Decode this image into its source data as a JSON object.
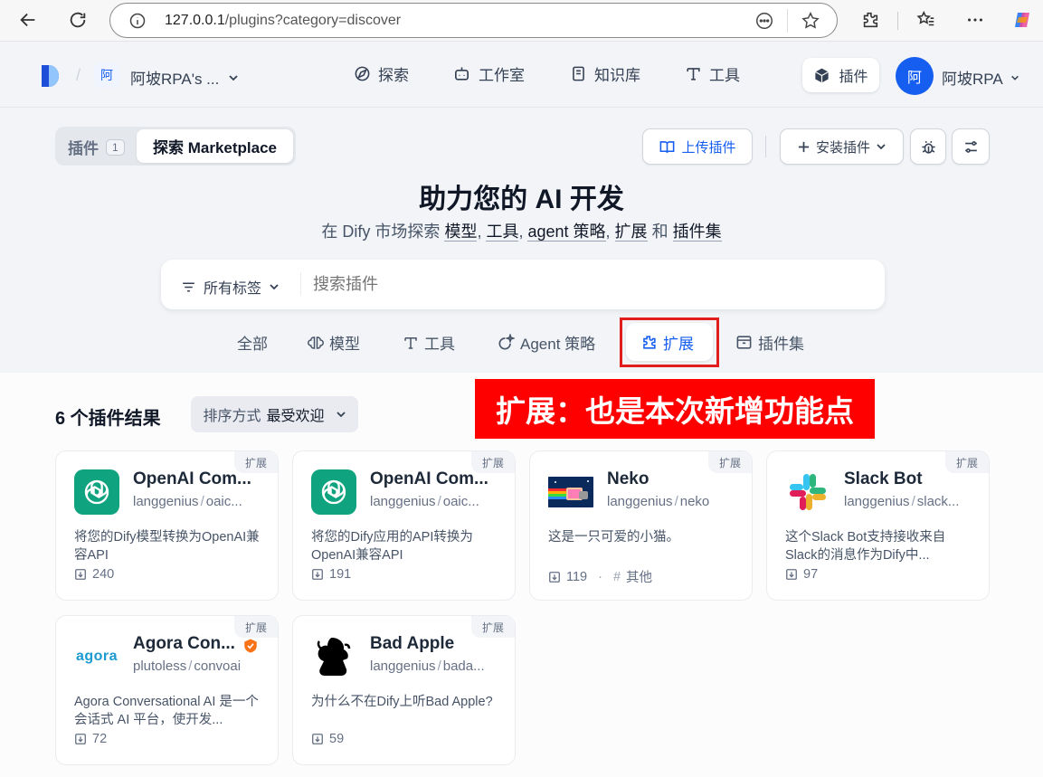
{
  "browser": {
    "url_host": "127.0.0.1",
    "url_path": "/plugins?category=discover"
  },
  "header": {
    "workspace_initial": "阿",
    "workspace_name": "阿坡RPA's ...",
    "nav": [
      "探索",
      "工作室",
      "知识库",
      "工具"
    ],
    "plugins_button": "插件",
    "user_initial": "阿",
    "user_name": "阿坡RPA"
  },
  "subheader": {
    "tab_plugins": "插件",
    "tab_plugins_count": "1",
    "tab_marketplace": "探索 Marketplace",
    "upload_button": "上传插件",
    "install_button": "安装插件"
  },
  "hero": {
    "title": "助力您的 AI 开发",
    "subtitle_prefix": "在 Dify 市场探索",
    "subtitle_items": [
      "模型",
      "工具",
      "agent 策略",
      "扩展"
    ],
    "subtitle_and": "和",
    "subtitle_last": "插件集"
  },
  "search": {
    "tags_label": "所有标签",
    "placeholder": "搜索插件"
  },
  "categories": [
    "全部",
    "模型",
    "工具",
    "Agent 策略",
    "扩展",
    "插件集"
  ],
  "active_category": "扩展",
  "annotation": {
    "text": "扩展：也是本次新增功能点",
    "color": "#ff0000"
  },
  "results": {
    "count_label": "6 个插件结果",
    "sort_prefix": "排序方式",
    "sort_value": "最受欢迎"
  },
  "cards": [
    {
      "title": "OpenAI Com...",
      "author": "langgenius",
      "slug": "oaic...",
      "badge": "扩展",
      "desc": "将您的Dify模型转换为OpenAI兼容API",
      "installs": "240",
      "logo": "openai-icon"
    },
    {
      "title": "OpenAI Com...",
      "author": "langgenius",
      "slug": "oaic...",
      "badge": "扩展",
      "desc": "将您的Dify应用的API转换为OpenAI兼容API",
      "installs": "191",
      "logo": "openai-icon"
    },
    {
      "title": "Neko",
      "author": "langgenius",
      "slug": "neko",
      "badge": "扩展",
      "desc": "这是一只可爱的小猫。",
      "installs": "119",
      "tag": "其他",
      "logo": "nyan-cat-icon"
    },
    {
      "title": "Slack Bot",
      "author": "langgenius",
      "slug": "slack...",
      "badge": "扩展",
      "desc": "这个Slack Bot支持接收来自Slack的消息作为Dify中...",
      "installs": "97",
      "logo": "slack-icon"
    },
    {
      "title": "Agora Con...",
      "author": "plutoless",
      "slug": "convoai",
      "badge": "扩展",
      "desc": "Agora Conversational AI 是一个会话式 AI 平台，使开发...",
      "installs": "72",
      "logo": "agora-icon",
      "logo_text": "agora"
    },
    {
      "title": "Bad Apple",
      "author": "langgenius",
      "slug": "bada...",
      "badge": "扩展",
      "desc": "为什么不在Dify上听Bad Apple?",
      "installs": "59",
      "logo": "bad-apple-icon"
    }
  ],
  "colors": {
    "accent": "#155eef",
    "openai_green": "#10a37f",
    "partner_orange": "#f97316"
  }
}
